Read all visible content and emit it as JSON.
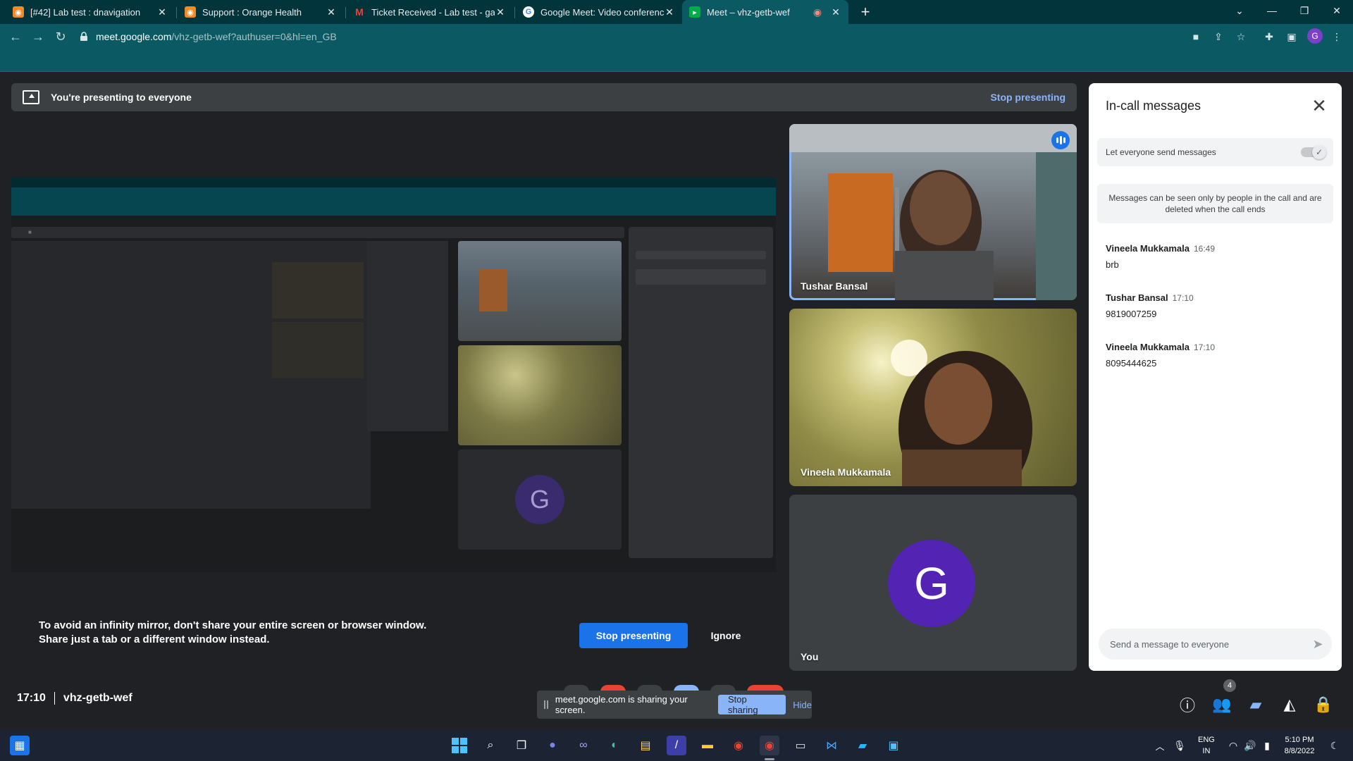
{
  "browser": {
    "tabs": [
      {
        "title": "[#42] Lab test : dnavigation",
        "icon": "orange-health-favicon",
        "color": "#f28b25"
      },
      {
        "title": "Support : Orange Health",
        "icon": "orange-health-favicon",
        "color": "#f28b25"
      },
      {
        "title": "Ticket Received - Lab test - gaura",
        "icon": "gmail-favicon",
        "color": "#ea4335"
      },
      {
        "title": "Google Meet: Video conferencing",
        "icon": "google-favicon",
        "color": "#ffffff"
      },
      {
        "title": "Meet – vhz-getb-wef",
        "icon": "meet-favicon",
        "color": "#00ac47"
      }
    ],
    "new_tab": "+",
    "url_host": "meet.google.com",
    "url_path": "/vhz-getb-wef?authuser=0&hl=en_GB",
    "profile_initial": "G"
  },
  "banner": {
    "message": "You're presenting to everyone",
    "stop_label": "Stop presenting"
  },
  "mirror_warning": {
    "text": "To avoid an infinity mirror, don't share your entire screen or browser window. Share just a tab or a different window instead.",
    "stop_label": "Stop presenting",
    "ignore_label": "Ignore"
  },
  "participants": [
    {
      "name": "Tushar Bansal",
      "speaking": true
    },
    {
      "name": "Vineela Mukkamala",
      "speaking": false
    },
    {
      "name": "You",
      "initial": "G",
      "avatar_color": "#5323b3"
    }
  ],
  "chat": {
    "title": "In-call messages",
    "toggle_label": "Let everyone send messages",
    "toggle_on": true,
    "info": "Messages can be seen only by people in the call and are deleted when the call ends",
    "messages": [
      {
        "sender": "Vineela Mukkamala",
        "time": "16:49",
        "text": "brb"
      },
      {
        "sender": "Tushar Bansal",
        "time": "17:10",
        "text": "9819007259"
      },
      {
        "sender": "Vineela Mukkamala",
        "time": "17:10",
        "text": "8095444625"
      }
    ],
    "input_placeholder": "Send a message to everyone"
  },
  "bottom": {
    "time": "17:10",
    "meeting_code": "vhz-getb-wef",
    "share_text": "meet.google.com is sharing your screen.",
    "stop_sharing": "Stop sharing",
    "hide": "Hide",
    "people_count": "4",
    "controls": [
      "info-icon",
      "people-icon",
      "chat-icon",
      "activities-icon",
      "host-controls-icon"
    ]
  },
  "taskbar": {
    "lang_line1": "ENG",
    "lang_line2": "IN",
    "time": "5:10 PM",
    "date": "8/8/2022"
  }
}
